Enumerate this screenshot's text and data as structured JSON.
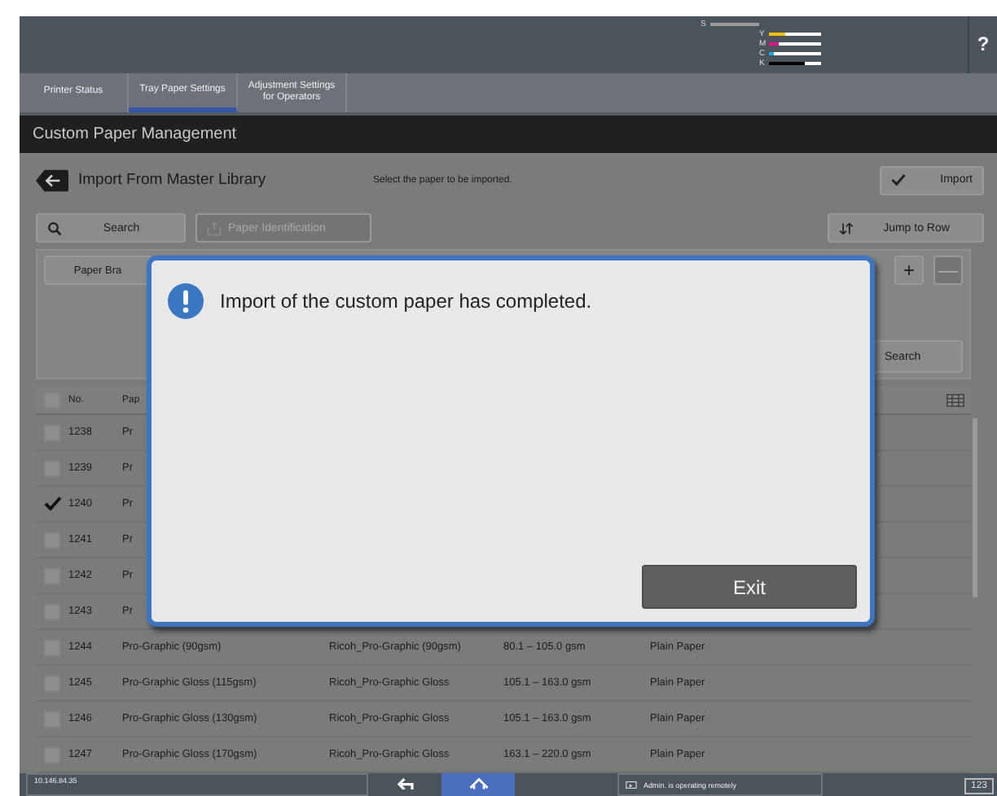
{
  "toner": [
    {
      "label": "S",
      "level": 1,
      "color": "#9a9a9a"
    },
    {
      "label": "Y",
      "level": 0.3,
      "color": "#f0c000"
    },
    {
      "label": "M",
      "level": 0.2,
      "color": "#e0138c"
    },
    {
      "label": "C",
      "level": 0.1,
      "color": "#19a8e0"
    },
    {
      "label": "K",
      "level": 0.7,
      "color": "#000000"
    }
  ],
  "help": "?",
  "tabs": [
    {
      "label": "Printer Status",
      "selected": false
    },
    {
      "label": "Tray Paper Settings",
      "selected": true
    },
    {
      "label": "Adjustment Settings for Operators",
      "selected": false
    }
  ],
  "title": "Custom Paper Management",
  "header": {
    "title": "Import From Master Library",
    "instruction": "Select the paper to be imported.",
    "import_button": "Import"
  },
  "toolbar": {
    "search": "Search",
    "paper_identification": {
      "label": "Paper Identification",
      "disabled": true
    },
    "jump": "Jump to Row"
  },
  "filter": {
    "brand_button": "Paper Bra",
    "add": "+",
    "remove": {
      "label": "—",
      "disabled": true
    },
    "search_button": "Search"
  },
  "table": {
    "select_all": false,
    "columns": [
      "No.",
      "Pap"
    ],
    "rows": [
      {
        "checked": false,
        "no": "1238",
        "name": "Pr"
      },
      {
        "checked": false,
        "no": "1239",
        "name": "Pr"
      },
      {
        "checked": true,
        "no": "1240",
        "name": "Pr"
      },
      {
        "checked": false,
        "no": "1241",
        "name": "Pr"
      },
      {
        "checked": false,
        "no": "1242",
        "name": "Pr"
      },
      {
        "checked": false,
        "no": "1243",
        "name": "Pr"
      },
      {
        "checked": false,
        "no": "1244",
        "name": "Pro-Graphic (90gsm)",
        "product": "Ricoh_Pro-Graphic (90gsm)",
        "weight": "80.1 – 105.0 gsm",
        "type": "Plain Paper"
      },
      {
        "checked": false,
        "no": "1245",
        "name": "Pro-Graphic Gloss (115gsm)",
        "product": "Ricoh_Pro-Graphic Gloss",
        "weight": "105.1 – 163.0 gsm",
        "type": "Plain Paper"
      },
      {
        "checked": false,
        "no": "1246",
        "name": "Pro-Graphic Gloss (130gsm)",
        "product": "Ricoh_Pro-Graphic Gloss",
        "weight": "105.1 – 163.0 gsm",
        "type": "Plain Paper"
      },
      {
        "checked": false,
        "no": "1247",
        "name": "Pro-Graphic Gloss (170gsm)",
        "product": "Ricoh_Pro-Graphic Gloss",
        "weight": "163.1 – 220.0 gsm",
        "type": "Plain Paper"
      }
    ]
  },
  "dialog": {
    "message": "Import of the custom paper has completed.",
    "button": "Exit"
  },
  "status_bar": {
    "address": "10.146.84.35",
    "remote": "Admin. is operating remotely",
    "keyboard": "123"
  }
}
